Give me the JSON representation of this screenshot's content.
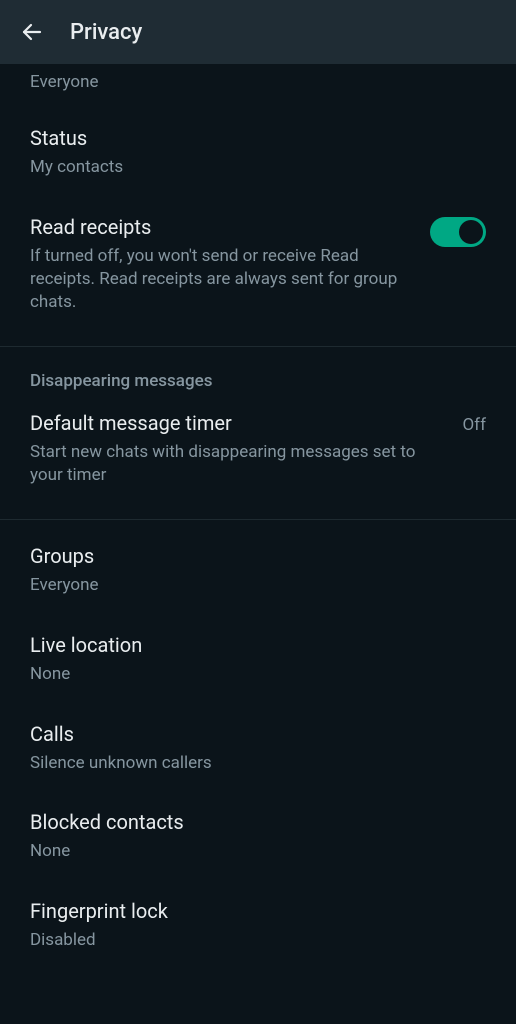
{
  "appbar": {
    "title": "Privacy"
  },
  "topValue": "Everyone",
  "status": {
    "title": "Status",
    "value": "My contacts"
  },
  "readReceipts": {
    "title": "Read receipts",
    "desc": "If turned off, you won't send or receive Read receipts. Read receipts are always sent for group chats."
  },
  "disappearing": {
    "header": "Disappearing messages",
    "timerTitle": "Default message timer",
    "timerDesc": "Start new chats with disappearing messages set to your timer",
    "timerValue": "Off"
  },
  "groups": {
    "title": "Groups",
    "value": "Everyone"
  },
  "liveLocation": {
    "title": "Live location",
    "value": "None"
  },
  "calls": {
    "title": "Calls",
    "value": "Silence unknown callers"
  },
  "blocked": {
    "title": "Blocked contacts",
    "value": "None"
  },
  "fingerprint": {
    "title": "Fingerprint lock",
    "value": "Disabled"
  }
}
